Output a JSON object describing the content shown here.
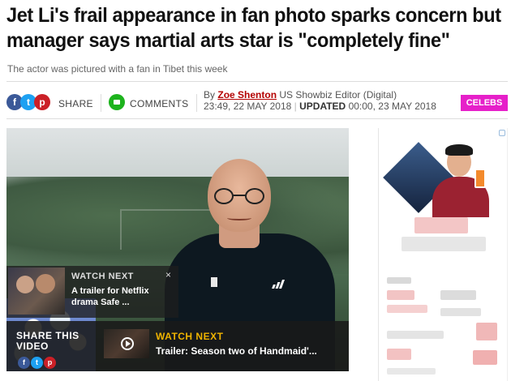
{
  "article": {
    "headline": "Jet Li's frail appearance in fan photo sparks concern but manager says martial arts star is \"completely fine\"",
    "subhead": "The actor was pictured with a fan in Tibet this week"
  },
  "share_bar": {
    "social_icons": [
      "facebook-icon",
      "twitter-icon",
      "pinterest-icon"
    ],
    "share_label": "SHARE",
    "comments_label": "COMMENTS",
    "by_prefix": "By",
    "author": "Zoe Shenton",
    "author_role": "US Showbiz Editor (Digital)",
    "published": "23:49, 22 MAY 2018",
    "updated_label": "UPDATED",
    "updated": "00:00, 23 MAY 2018",
    "section_badge": "CELEBS",
    "badge_color": "#e620c9"
  },
  "video": {
    "watch_next_overlay": {
      "heading": "WATCH NEXT",
      "text": "A trailer for Netflix drama Safe ...",
      "close": "×"
    },
    "bottom_bar": {
      "share_heading_1": "SHARE THIS",
      "share_heading_2": "VIDEO",
      "watch_next_heading": "WATCH NEXT",
      "watch_next_title": "Trailer: Season two of Handmaid'..."
    }
  },
  "colors": {
    "author_link": "#b40000",
    "watch_next_accent": "#f0b400"
  }
}
